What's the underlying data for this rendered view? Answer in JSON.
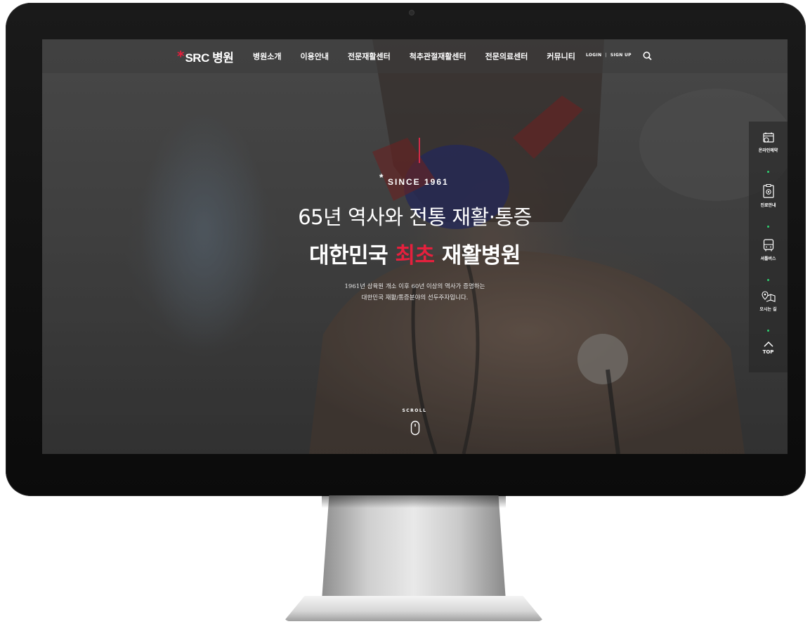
{
  "header": {
    "logo_text": "SRC 병원",
    "nav": [
      "병원소개",
      "이용안내",
      "전문재활센터",
      "척추관절재활센터",
      "전문의료센터",
      "커뮤니티"
    ],
    "login_label": "LOGIN",
    "signup_label": "SIGN UP",
    "search_icon": "search-icon"
  },
  "hero": {
    "since": "SINCE 1961",
    "headline_line1": "65년 역사와 전통 재활·통증",
    "headline_line2_before": "대한민국 ",
    "headline_line2_highlight": "최초",
    "headline_line2_after": " 재활병원",
    "description_line1": "1961년 삼육원 개소 이후 60년 이상의 역사가 증명하는",
    "description_line2": "대한민국 재활/통증분야의 선두주자입니다.",
    "scroll_label": "SCROLL"
  },
  "quick_menu": {
    "items": [
      {
        "label": "온라인예약",
        "icon": "calendar-clock-icon"
      },
      {
        "label": "진료안내",
        "icon": "clipboard-icon"
      },
      {
        "label": "셔틀버스",
        "icon": "bus-icon"
      },
      {
        "label": "오시는 길",
        "icon": "map-pin-icon"
      }
    ],
    "top_label": "TOP"
  },
  "colors": {
    "accent_red": "#e6203d",
    "dot_green": "#2ecf6f",
    "header_bg": "rgba(60,60,60,0.55)"
  }
}
